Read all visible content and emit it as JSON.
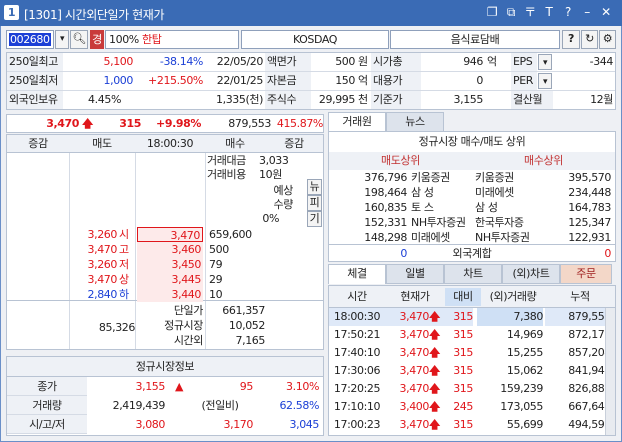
{
  "titlebar": {
    "badge": "1",
    "title": "[1301] 시간외단일가 현재가",
    "icons": [
      "restore-icon",
      "pages-icon",
      "pin-icon",
      "font-icon",
      "help-icon",
      "minimize-icon",
      "close-icon"
    ],
    "icon_glyphs": [
      "❐",
      "⧉",
      "〒",
      "T",
      "?",
      "–",
      "✕"
    ]
  },
  "toolbar": {
    "code": "002680",
    "market_badge": "경",
    "percent": "100%",
    "name": "한탑",
    "market": "KOSDAQ",
    "sector": "음식료담배",
    "help": "?",
    "refresh": "↻",
    "settings": "⚙"
  },
  "info": {
    "r1": {
      "l": "250일최고",
      "v": "5,100",
      "pct": "-38.14%",
      "date": "22/05/20",
      "l2": "액면가",
      "v2": "500",
      "u2": "원",
      "l3": "시가총",
      "v3": "946",
      "u3": "억",
      "l4": "EPS",
      "v4": "-344"
    },
    "r2": {
      "l": "250일최저",
      "v": "1,000",
      "pct": "+215.50%",
      "date": "22/01/25",
      "l2": "자본금",
      "v2": "150",
      "u2": "억",
      "l3": "대용가",
      "v3": "0",
      "l4": "PER",
      "v4": ""
    },
    "r3": {
      "l": "외국인보유",
      "v": "4.45%",
      "v1": "1,335(천)",
      "l2": "주식수",
      "v2": "29,995",
      "u2": "천",
      "l3": "기준가",
      "v3": "3,155",
      "l4": "결산월",
      "v4": "12월"
    }
  },
  "quote": {
    "price": "3,470",
    "change": "315",
    "pct": "+9.98%",
    "volume": "879,553",
    "vol_pct": "415.87%"
  },
  "ob": {
    "headers": [
      "증감",
      "매도",
      "18:00:30",
      "매수",
      "증감"
    ],
    "info_labels": [
      "거래대금",
      "거래비용"
    ],
    "info_values": [
      "3,033",
      "10원"
    ],
    "exp_labels": [
      "예상",
      "수량"
    ],
    "exp_pct": "0%",
    "side_buttons": [
      "뉴",
      "피",
      "기"
    ],
    "asks": [
      {
        "tag": "",
        "price": "3,470",
        "qty": "659,600"
      },
      {
        "tag": "",
        "price": "3,460",
        "qty": "500"
      },
      {
        "tag": "",
        "price": "3,450",
        "qty": "79"
      },
      {
        "tag": "",
        "price": "3,445",
        "qty": "29"
      },
      {
        "tag": "",
        "price": "3,440",
        "qty": "10"
      }
    ],
    "ref": [
      {
        "p": "3,260",
        "t": "시"
      },
      {
        "p": "3,470",
        "t": "고"
      },
      {
        "p": "3,260",
        "t": "저"
      },
      {
        "p": "3,470",
        "t": "상"
      },
      {
        "p": "2,840",
        "t": "하"
      }
    ],
    "sell_total": "85,326",
    "totals": [
      {
        "l": "단일가",
        "v": "661,357"
      },
      {
        "l": "정규시장",
        "v": "10,052"
      },
      {
        "l": "시간외",
        "v": "7,165"
      }
    ]
  },
  "regular": {
    "title": "정규시장정보",
    "rows": [
      {
        "l": "종가",
        "a": "3,155",
        "b": "95",
        "c": "3.10%"
      },
      {
        "l": "거래량",
        "a": "2,419,439",
        "b": "(전일비)",
        "c": "62.58%"
      },
      {
        "l": "시/고/저",
        "a": "3,080",
        "b": "3,170",
        "c": "3,045"
      }
    ]
  },
  "broker": {
    "tabs": [
      "거래원",
      "뉴스"
    ],
    "title": "정규시장 매수/매도 상위",
    "sell_h": "매도상위",
    "buy_h": "매수상위",
    "rows": [
      {
        "sv": "376,796",
        "sn": "키움증권",
        "bn": "키움증권",
        "bv": "395,570"
      },
      {
        "sv": "198,464",
        "sn": "삼 성",
        "bn": "미래에셋",
        "bv": "234,448"
      },
      {
        "sv": "160,835",
        "sn": "토 스",
        "bn": "삼 성",
        "bv": "164,783"
      },
      {
        "sv": "152,331",
        "sn": "NH투자증권",
        "bn": "한국투자증",
        "bv": "125,347"
      },
      {
        "sv": "148,298",
        "sn": "미래에셋",
        "bn": "NH투자증권",
        "bv": "122,931"
      }
    ],
    "foreign": {
      "l": "외국계합",
      "sv": "0",
      "bv": "0"
    }
  },
  "trades": {
    "tabs": [
      "체결",
      "일별",
      "차트",
      "(외)차트",
      "주문"
    ],
    "headers": [
      "시간",
      "현재가",
      "대비",
      "(외)거래량",
      "누적"
    ],
    "rows": [
      {
        "t": "18:00:30",
        "p": "3,470",
        "c": "315",
        "v": "7,380",
        "a": "879,553"
      },
      {
        "t": "17:50:21",
        "p": "3,470",
        "c": "315",
        "v": "14,969",
        "a": "872,173"
      },
      {
        "t": "17:40:10",
        "p": "3,470",
        "c": "315",
        "v": "15,255",
        "a": "857,204"
      },
      {
        "t": "17:30:06",
        "p": "3,470",
        "c": "315",
        "v": "15,062",
        "a": "841,949"
      },
      {
        "t": "17:20:25",
        "p": "3,470",
        "c": "315",
        "v": "159,239",
        "a": "826,887"
      },
      {
        "t": "17:10:10",
        "p": "3,400",
        "c": "245",
        "v": "173,055",
        "a": "667,648"
      },
      {
        "t": "17:00:23",
        "p": "3,470",
        "c": "315",
        "v": "55,699",
        "a": "494,593"
      }
    ]
  }
}
